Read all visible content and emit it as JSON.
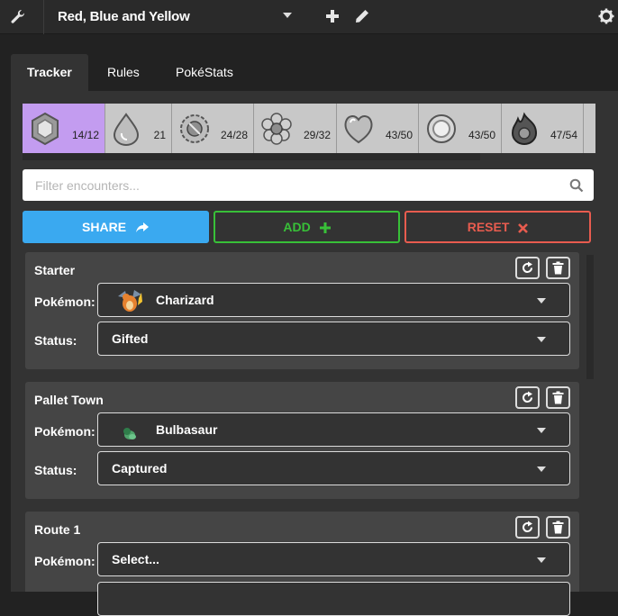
{
  "header": {
    "game_title": "Red, Blue and Yellow"
  },
  "tabs": [
    {
      "label": "Tracker"
    },
    {
      "label": "Rules"
    },
    {
      "label": "PokéStats"
    }
  ],
  "badges": [
    {
      "name": "boulder-badge-icon",
      "count": "14/12",
      "active": true
    },
    {
      "name": "cascade-badge-icon",
      "count": "21",
      "active": false
    },
    {
      "name": "thunder-badge-icon",
      "count": "24/28",
      "active": false
    },
    {
      "name": "rainbow-badge-icon",
      "count": "29/32",
      "active": false
    },
    {
      "name": "soul-badge-icon",
      "count": "43/50",
      "active": false
    },
    {
      "name": "marsh-badge-icon",
      "count": "43/50",
      "active": false
    },
    {
      "name": "volcano-badge-icon",
      "count": "47/54",
      "active": false
    }
  ],
  "filter": {
    "placeholder": "Filter encounters..."
  },
  "actions": {
    "share": "SHARE",
    "add": "ADD",
    "reset": "RESET"
  },
  "labels": {
    "pokemon": "Pokémon:",
    "status": "Status:"
  },
  "encounters": [
    {
      "location": "Starter",
      "pokemon": "Charizard",
      "status": "Gifted"
    },
    {
      "location": "Pallet Town",
      "pokemon": "Bulbasaur",
      "status": "Captured"
    },
    {
      "location": "Route 1",
      "pokemon": "Select...",
      "status": ""
    }
  ],
  "colors": {
    "share": "#3aa9f0",
    "add": "#38c038",
    "reset": "#e85c4f",
    "active_badge": "#c39cf0"
  }
}
